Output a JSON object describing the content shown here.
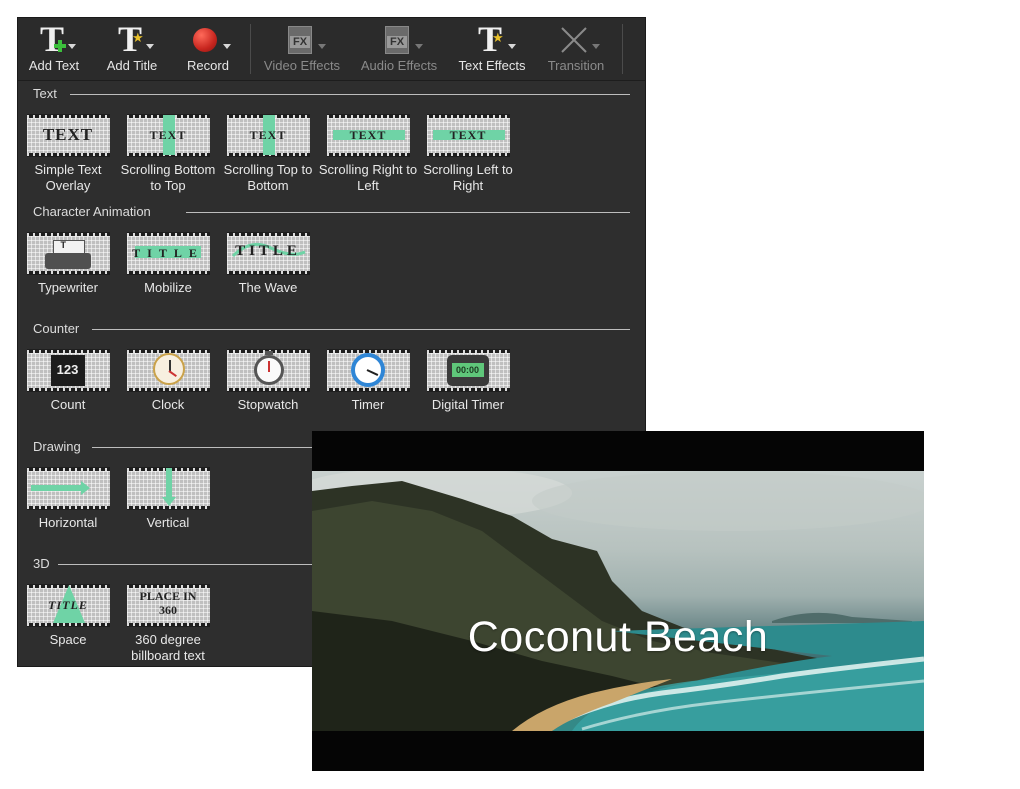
{
  "toolbar": {
    "buttons": [
      {
        "label": "Add Text",
        "icon": "add-text-icon",
        "enabled": true
      },
      {
        "label": "Add Title",
        "icon": "add-title-icon",
        "enabled": true
      },
      {
        "label": "Record",
        "icon": "record-icon",
        "enabled": true
      },
      {
        "label": "Video Effects",
        "icon": "video-fx-icon",
        "enabled": false
      },
      {
        "label": "Audio Effects",
        "icon": "audio-fx-icon",
        "enabled": false
      },
      {
        "label": "Text Effects",
        "icon": "text-effects-icon",
        "enabled": true
      },
      {
        "label": "Transition",
        "icon": "transition-icon",
        "enabled": false
      }
    ]
  },
  "sections": {
    "text": {
      "title": "Text",
      "items": [
        {
          "label": "Simple Text Overlay",
          "thumb_text": "TEXT"
        },
        {
          "label": "Scrolling Bottom to Top",
          "thumb_text": "TEXT"
        },
        {
          "label": "Scrolling Top to Bottom",
          "thumb_text": "TEXT"
        },
        {
          "label": "Scrolling Right to Left",
          "thumb_text": "TEXT"
        },
        {
          "label": "Scrolling Left to Right",
          "thumb_text": "TEXT"
        }
      ]
    },
    "character_animation": {
      "title": "Character Animation",
      "items": [
        {
          "label": "Typewriter",
          "thumb_text": "T"
        },
        {
          "label": "Mobilize",
          "thumb_text": "TITLE"
        },
        {
          "label": "The Wave",
          "thumb_text": "TITLE"
        }
      ]
    },
    "counter": {
      "title": "Counter",
      "items": [
        {
          "label": "Count",
          "thumb_text": "123"
        },
        {
          "label": "Clock",
          "thumb_text": ""
        },
        {
          "label": "Stopwatch",
          "thumb_text": ""
        },
        {
          "label": "Timer",
          "thumb_text": ""
        },
        {
          "label": "Digital Timer",
          "thumb_text": "00:00"
        }
      ]
    },
    "drawing": {
      "title": "Drawing",
      "items": [
        {
          "label": "Horizontal"
        },
        {
          "label": "Vertical"
        }
      ]
    },
    "three_d": {
      "title": "3D",
      "items": [
        {
          "label": "Space",
          "thumb_text": "TITLE"
        },
        {
          "label": "360 degree billboard text",
          "thumb_text": "PLACE IN 360"
        }
      ]
    }
  },
  "preview": {
    "caption": "Coconut Beach"
  },
  "colors": {
    "panel_bg": "#2e2e2e",
    "accent_mint": "#6fd3a6",
    "record_red": "#c8261f"
  }
}
